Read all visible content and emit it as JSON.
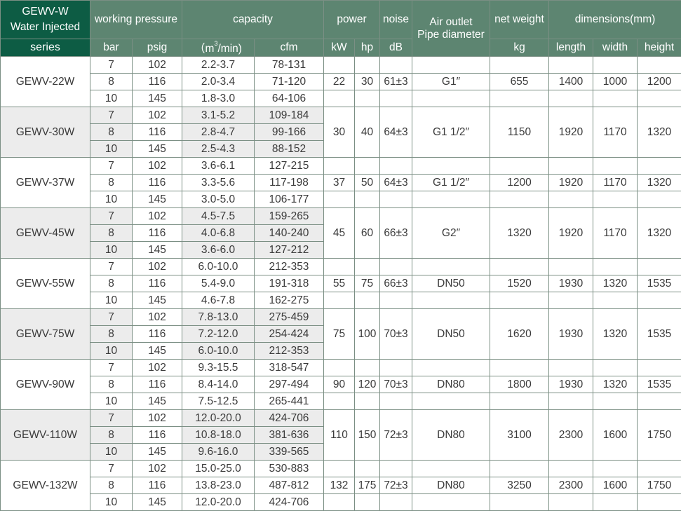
{
  "header": {
    "series_line1": "GEWV-W",
    "series_line2": "Water Injected",
    "working_pressure": "working pressure",
    "capacity": "capacity",
    "power": "power",
    "noise": "noise",
    "air_outlet_line1": "Air outlet",
    "air_outlet_line2": "Pipe diameter",
    "net_weight": "net weight",
    "dimensions": "dimensions(mm)"
  },
  "subheader": {
    "series": "series",
    "bar": "bar",
    "psig": "psig",
    "capacity_unit_open": "（m",
    "capacity_unit_sup": "3",
    "capacity_unit_close": "/min)",
    "cfm": "cfm",
    "kw": "kW",
    "hp": "hp",
    "db": "dB",
    "kg": "kg",
    "length": "length",
    "width": "width",
    "height": "height"
  },
  "models": [
    {
      "name": "GEWV-22W",
      "shaded": false,
      "kw": "22",
      "hp": "30",
      "noise": "61±3",
      "outlet": "G1″",
      "weight": "655",
      "length": "1400",
      "width": "1000",
      "height": "1200",
      "rows": [
        {
          "bar": "7",
          "psig": "102",
          "m3": "2.2-3.7",
          "cfm": "78-131"
        },
        {
          "bar": "8",
          "psig": "116",
          "m3": "2.0-3.4",
          "cfm": "71-120"
        },
        {
          "bar": "10",
          "psig": "145",
          "m3": "1.8-3.0",
          "cfm": "64-106"
        }
      ]
    },
    {
      "name": "GEWV-30W",
      "shaded": true,
      "kw": "30",
      "hp": "40",
      "noise": "64±3",
      "outlet": "G1 1/2″",
      "weight": "1150",
      "length": "1920",
      "width": "1170",
      "height": "1320",
      "rows": [
        {
          "bar": "7",
          "psig": "102",
          "m3": "3.1-5.2",
          "cfm": "109-184"
        },
        {
          "bar": "8",
          "psig": "116",
          "m3": "2.8-4.7",
          "cfm": "99-166"
        },
        {
          "bar": "10",
          "psig": "145",
          "m3": "2.5-4.3",
          "cfm": "88-152"
        }
      ]
    },
    {
      "name": "GEWV-37W",
      "shaded": false,
      "kw": "37",
      "hp": "50",
      "noise": "64±3",
      "outlet": "G1 1/2″",
      "weight": "1200",
      "length": "1920",
      "width": "1170",
      "height": "1320",
      "rows": [
        {
          "bar": "7",
          "psig": "102",
          "m3": "3.6-6.1",
          "cfm": "127-215"
        },
        {
          "bar": "8",
          "psig": "116",
          "m3": "3.3-5.6",
          "cfm": "117-198"
        },
        {
          "bar": "10",
          "psig": "145",
          "m3": "3.0-5.0",
          "cfm": "106-177"
        }
      ]
    },
    {
      "name": "GEWV-45W",
      "shaded": true,
      "kw": "45",
      "hp": "60",
      "noise": "66±3",
      "outlet": "G2″",
      "weight": "1320",
      "length": "1920",
      "width": "1170",
      "height": "1320",
      "rows": [
        {
          "bar": "7",
          "psig": "102",
          "m3": "4.5-7.5",
          "cfm": "159-265"
        },
        {
          "bar": "8",
          "psig": "116",
          "m3": "4.0-6.8",
          "cfm": "140-240"
        },
        {
          "bar": "10",
          "psig": "145",
          "m3": "3.6-6.0",
          "cfm": "127-212"
        }
      ]
    },
    {
      "name": "GEWV-55W",
      "shaded": false,
      "kw": "55",
      "hp": "75",
      "noise": "66±3",
      "outlet": "DN50",
      "weight": "1520",
      "length": "1930",
      "width": "1320",
      "height": "1535",
      "rows": [
        {
          "bar": "7",
          "psig": "102",
          "m3": "6.0-10.0",
          "cfm": "212-353"
        },
        {
          "bar": "8",
          "psig": "116",
          "m3": "5.4-9.0",
          "cfm": "191-318"
        },
        {
          "bar": "10",
          "psig": "145",
          "m3": "4.6-7.8",
          "cfm": "162-275"
        }
      ]
    },
    {
      "name": "GEWV-75W",
      "shaded": true,
      "kw": "75",
      "hp": "100",
      "noise": "70±3",
      "outlet": "DN50",
      "weight": "1620",
      "length": "1930",
      "width": "1320",
      "height": "1535",
      "rows": [
        {
          "bar": "7",
          "psig": "102",
          "m3": "7.8-13.0",
          "cfm": "275-459"
        },
        {
          "bar": "8",
          "psig": "116",
          "m3": "7.2-12.0",
          "cfm": "254-424"
        },
        {
          "bar": "10",
          "psig": "145",
          "m3": "6.0-10.0",
          "cfm": "212-353"
        }
      ]
    },
    {
      "name": "GEWV-90W",
      "shaded": false,
      "kw": "90",
      "hp": "120",
      "noise": "70±3",
      "outlet": "DN80",
      "weight": "1800",
      "length": "1930",
      "width": "1320",
      "height": "1535",
      "rows": [
        {
          "bar": "7",
          "psig": "102",
          "m3": "9.3-15.5",
          "cfm": "318-547"
        },
        {
          "bar": "8",
          "psig": "116",
          "m3": "8.4-14.0",
          "cfm": "297-494"
        },
        {
          "bar": "10",
          "psig": "145",
          "m3": "7.5-12.5",
          "cfm": "265-441"
        }
      ]
    },
    {
      "name": "GEWV-110W",
      "shaded": true,
      "kw": "110",
      "hp": "150",
      "noise": "72±3",
      "outlet": "DN80",
      "weight": "3100",
      "length": "2300",
      "width": "1600",
      "height": "1750",
      "rows": [
        {
          "bar": "7",
          "psig": "102",
          "m3": "12.0-20.0",
          "cfm": "424-706"
        },
        {
          "bar": "8",
          "psig": "116",
          "m3": "10.8-18.0",
          "cfm": "381-636"
        },
        {
          "bar": "10",
          "psig": "145",
          "m3": "9.6-16.0",
          "cfm": "339-565"
        }
      ]
    },
    {
      "name": "GEWV-132W",
      "shaded": false,
      "kw": "132",
      "hp": "175",
      "noise": "72±3",
      "outlet": "DN80",
      "weight": "3250",
      "length": "2300",
      "width": "1600",
      "height": "1750",
      "rows": [
        {
          "bar": "7",
          "psig": "102",
          "m3": "15.0-25.0",
          "cfm": "530-883"
        },
        {
          "bar": "8",
          "psig": "116",
          "m3": "13.8-23.0",
          "cfm": "487-812"
        },
        {
          "bar": "10",
          "psig": "145",
          "m3": "12.0-20.0",
          "cfm": "424-706"
        }
      ]
    }
  ]
}
